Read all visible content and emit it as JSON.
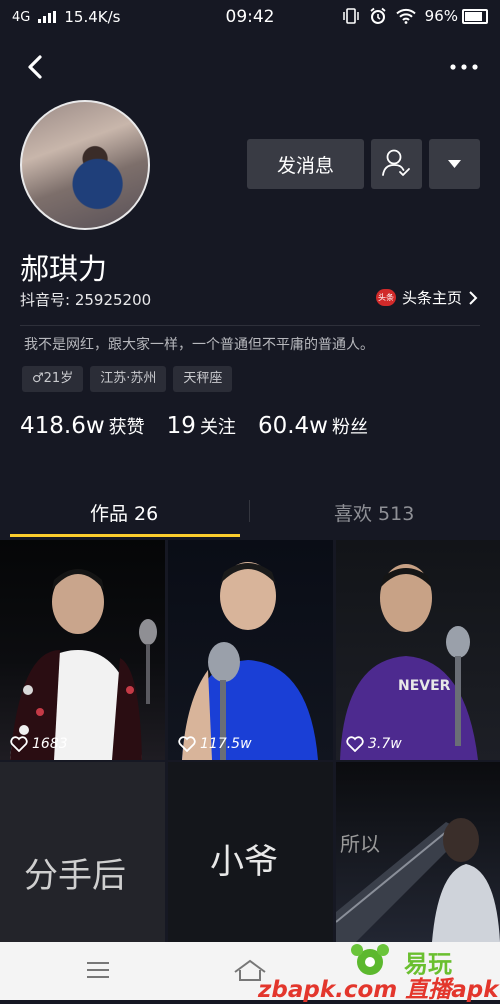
{
  "status_bar": {
    "network": "4G",
    "speed": "15.4K/s",
    "time": "09:42",
    "battery": "96%"
  },
  "profile": {
    "nickname": "郝琪力",
    "douyin_id": "抖音号: 25925200",
    "toutiao_logo_text": "头条",
    "toutiao_link": "头条主页",
    "bio": "我不是网红，跟大家一样，一个普通但不平庸的普通人。",
    "tags": [
      "♂21岁",
      "江苏·苏州",
      "天秤座"
    ],
    "stats": [
      {
        "value": "418.6w",
        "label": "获赞"
      },
      {
        "value": "19",
        "label": "关注"
      },
      {
        "value": "60.4w",
        "label": "粉丝"
      }
    ]
  },
  "actions": {
    "message_label": "发消息"
  },
  "tabs": {
    "works": "作品 26",
    "likes": "喜欢 513",
    "active": "works",
    "active_color": "#facd2d"
  },
  "videos": [
    {
      "likes": "1683",
      "caption": ""
    },
    {
      "likes": "117.5w",
      "caption": ""
    },
    {
      "likes": "3.7w",
      "caption": ""
    },
    {
      "likes": "",
      "caption": "分手后"
    },
    {
      "likes": "",
      "caption": "小爷"
    },
    {
      "likes": "",
      "caption": "所以"
    }
  ],
  "watermark": {
    "brand": "易玩",
    "url": "zbapk.com 直播apk"
  },
  "colors": {
    "background": "#161823",
    "button": "#393b44",
    "accent": "#facd2d"
  }
}
